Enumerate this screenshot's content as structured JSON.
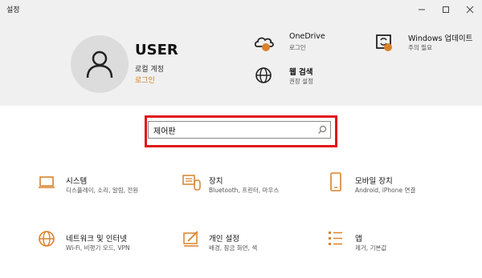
{
  "window": {
    "title": "설정"
  },
  "account": {
    "name": "USER",
    "type": "로컬 계정",
    "signin": "로그인"
  },
  "header_items": [
    {
      "title": "OneDrive",
      "desc": "로그인"
    },
    {
      "title": "Windows 업데이트",
      "desc": "주의 필요"
    },
    {
      "title": "웹 검색",
      "desc": "권장 설정"
    }
  ],
  "search": {
    "value": "제어판"
  },
  "categories": [
    {
      "title": "시스템",
      "desc": "디스플레이, 소리, 알림, 전원"
    },
    {
      "title": "장치",
      "desc": "Bluetooth, 프린터, 마우스"
    },
    {
      "title": "모바일 장치",
      "desc": "Android, iPhone 연결"
    },
    {
      "title": "네트워크 및 인터넷",
      "desc": "Wi-Fi, 비행기 모드, VPN"
    },
    {
      "title": "개인 설정",
      "desc": "배경, 잠금 화면, 색"
    },
    {
      "title": "앱",
      "desc": "제거, 기본값"
    }
  ],
  "colors": {
    "accent": "#d9822b",
    "highlight": "#e01414"
  }
}
